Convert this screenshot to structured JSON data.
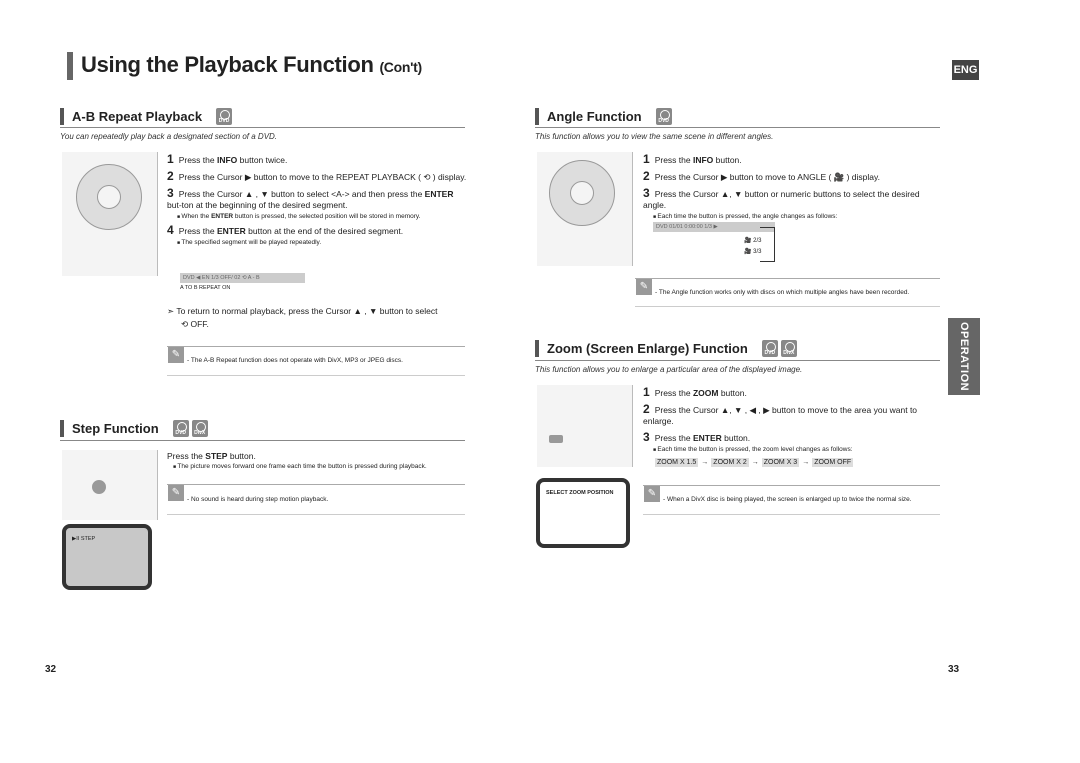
{
  "header": {
    "title": "Using the Playback Function",
    "title_suffix": "(Con't)",
    "lang_badge": "ENG"
  },
  "side_tab": "OPERATION",
  "ab_repeat": {
    "heading": "A-B Repeat Playback",
    "discs": [
      "DVD"
    ],
    "subtitle": "You can repeatedly play back a designated section of a DVD.",
    "steps": [
      {
        "n": "1",
        "pre": "Press the ",
        "bold": "INFO",
        "post": " button twice."
      },
      {
        "n": "2",
        "pre": "Press the Cursor ▶ button to move to the REPEAT PLAYBACK ( ⟲ ) display.",
        "bold": "",
        "post": ""
      },
      {
        "n": "3",
        "pre": "Press the Cursor ▲ , ▼ button to select <A-> and then press the ",
        "bold": "ENTER",
        "post": " but-ton at the beginning of the desired segment."
      },
      {
        "n": "4",
        "pre": "Press the ",
        "bold": "ENTER",
        "post": " button at the end of the desired segment."
      }
    ],
    "bullet3_pre": "When the ",
    "bullet3_bold": "ENTER",
    "bullet3_post": " button is pressed, the selected position will be stored in memory.",
    "bullet4": "The specified segment will be played repeatedly.",
    "display_bar": "DVD ◀ EN 1/3  OFF/ 02  ⟲ A - B",
    "display_caption": "A TO B REPEAT ON",
    "tip": "To return to normal playback, press the Cursor ▲ , ▼ button to select",
    "tip_off": "⟲ OFF.",
    "note": "- The A-B Repeat function does not operate with DivX, MP3 or JPEG discs."
  },
  "step_fn": {
    "heading": "Step Function",
    "discs": [
      "DVD",
      "DivX"
    ],
    "step_pre": "Press the ",
    "step_bold": "STEP",
    "step_post": " button.",
    "bullet": "The picture moves forward one frame each time the button is pressed during playback.",
    "note": "- No sound is heard during step motion playback.",
    "screen_text": "▶II STEP"
  },
  "angle": {
    "heading": "Angle Function",
    "discs": [
      "DVD"
    ],
    "subtitle": "This function allows you to view the same scene in different angles.",
    "steps": [
      {
        "n": "1",
        "pre": "Press the ",
        "bold": "INFO",
        "post": " button."
      },
      {
        "n": "2",
        "pre": "Press the Cursor ▶ button to move to ANGLE ( 🎥 ) display.",
        "bold": "",
        "post": ""
      },
      {
        "n": "3",
        "pre": "Press the Cursor ▲, ▼ button or numeric buttons to select the desired angle.",
        "bold": "",
        "post": ""
      }
    ],
    "bullet": "Each time the button is pressed, the angle changes as follows:",
    "display_bar": "DVD  01/01  0:00:00  1/3 ▶",
    "angles": [
      "2/3",
      "3/3"
    ],
    "note": "- The Angle function works only with discs on which multiple angles have been recorded."
  },
  "zoom": {
    "heading": "Zoom (Screen Enlarge) Function",
    "discs": [
      "DVD",
      "DivX"
    ],
    "subtitle": "This function allows you to enlarge a particular area of the displayed image.",
    "steps": [
      {
        "n": "1",
        "pre": "Press the ",
        "bold": "ZOOM",
        "post": " button."
      },
      {
        "n": "2",
        "pre": "Press the Cursor ▲, ▼ , ◀ , ▶ button to move to the area you want to enlarge.",
        "bold": "",
        "post": ""
      },
      {
        "n": "3",
        "pre": "Press the ",
        "bold": "ENTER",
        "post": " button."
      }
    ],
    "bullet": "Each time the button is pressed, the zoom level changes as follows:",
    "chain": [
      "ZOOM X 1.5",
      "ZOOM X 2",
      "ZOOM X 3",
      "ZOOM OFF"
    ],
    "screen_text": "SELECT ZOOM POSITION",
    "note": "- When a DivX disc is being played, the screen is enlarged up to twice the normal size."
  },
  "page_numbers": {
    "left": "32",
    "right": "33"
  }
}
